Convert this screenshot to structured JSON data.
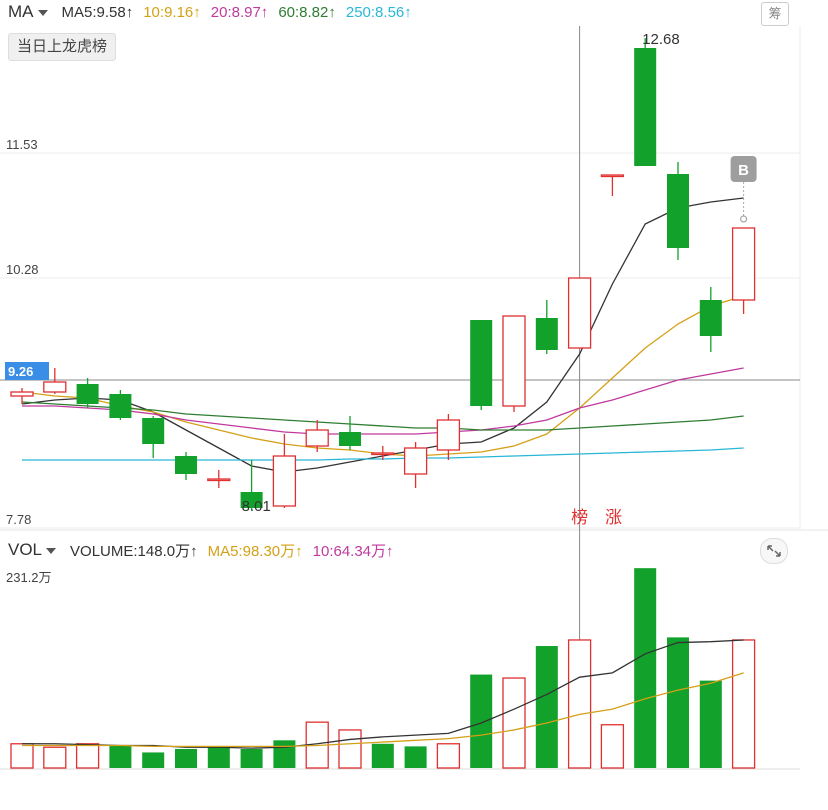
{
  "main_panel": {
    "indicator": "MA",
    "ma_values": [
      {
        "label": "MA5:9.58↑",
        "color": "#333333"
      },
      {
        "label": "10:9.16↑",
        "color": "#d4a017"
      },
      {
        "label": "20:8.97↑",
        "color": "#c0399f"
      },
      {
        "label": "60:8.82↑",
        "color": "#2e7d32"
      },
      {
        "label": "250:8.56↑",
        "color": "#29b6d8"
      }
    ],
    "button_label": "当日上龙虎榜",
    "right_badge": "筹"
  },
  "volume_panel": {
    "indicator": "VOL",
    "values": [
      {
        "label": "VOLUME:148.0万↑",
        "color": "#333333"
      },
      {
        "label": "MA5:98.30万↑",
        "color": "#d4a017"
      },
      {
        "label": "10:64.34万↑",
        "color": "#c0399f"
      }
    ]
  },
  "colors": {
    "up": "#e03030",
    "down": "#12a12a",
    "ma5": "#333333",
    "ma10": "#d4a017",
    "ma20": "#c0399f",
    "ma60": "#2e7d32",
    "ma250": "#29b6d8"
  },
  "chart_data": [
    {
      "type": "candlestick",
      "y_labels": [
        "11.53",
        "10.28",
        "7.78"
      ],
      "y_ticks": [
        11.53,
        10.28,
        7.78
      ],
      "ylim": [
        7.78,
        12.78
      ],
      "current_price_label": "9.26",
      "current_price": 9.26,
      "high_label": "12.68",
      "low_label": "8.01",
      "markers": [
        "B",
        "榜",
        "涨"
      ],
      "candles": [
        {
          "o": 9.1,
          "c": 9.14,
          "h": 9.18,
          "l": 9.02
        },
        {
          "o": 9.14,
          "c": 9.24,
          "h": 9.38,
          "l": 9.12
        },
        {
          "o": 9.22,
          "c": 9.02,
          "h": 9.28,
          "l": 8.98
        },
        {
          "o": 9.12,
          "c": 8.88,
          "h": 9.16,
          "l": 8.86
        },
        {
          "o": 8.88,
          "c": 8.62,
          "h": 8.9,
          "l": 8.48
        },
        {
          "o": 8.5,
          "c": 8.32,
          "h": 8.54,
          "l": 8.26
        },
        {
          "o": 8.27,
          "c": 8.27,
          "h": 8.36,
          "l": 8.18
        },
        {
          "o": 8.14,
          "c": 7.98,
          "h": 8.46,
          "l": 7.96
        },
        {
          "o": 8.0,
          "c": 8.5,
          "h": 8.72,
          "l": 7.98
        },
        {
          "o": 8.6,
          "c": 8.76,
          "h": 8.86,
          "l": 8.54
        },
        {
          "o": 8.74,
          "c": 8.6,
          "h": 8.9,
          "l": 8.56
        },
        {
          "o": 8.53,
          "c": 8.53,
          "h": 8.6,
          "l": 8.46
        },
        {
          "o": 8.32,
          "c": 8.58,
          "h": 8.64,
          "l": 8.18
        },
        {
          "o": 8.56,
          "c": 8.86,
          "h": 8.92,
          "l": 8.46
        },
        {
          "o": 9.86,
          "c": 9.0,
          "h": 9.86,
          "l": 8.96
        },
        {
          "o": 9.0,
          "c": 9.9,
          "h": 9.9,
          "l": 8.94
        },
        {
          "o": 9.88,
          "c": 9.56,
          "h": 10.06,
          "l": 9.52
        },
        {
          "o": 9.58,
          "c": 10.28,
          "h": 10.28,
          "l": 9.58
        },
        {
          "o": 11.31,
          "c": 11.31,
          "h": 11.31,
          "l": 11.1
        },
        {
          "o": 12.58,
          "c": 11.4,
          "h": 12.68,
          "l": 11.4
        },
        {
          "o": 11.32,
          "c": 10.58,
          "h": 11.44,
          "l": 10.46
        },
        {
          "o": 10.06,
          "c": 9.7,
          "h": 10.19,
          "l": 9.54
        },
        {
          "o": 10.06,
          "c": 10.78,
          "h": 10.78,
          "l": 9.92
        }
      ],
      "series": [
        {
          "key": "ma5",
          "values": [
            9.02,
            9.06,
            9.08,
            9.06,
            8.94,
            8.76,
            8.58,
            8.4,
            8.34,
            8.38,
            8.44,
            8.5,
            8.56,
            8.62,
            8.64,
            8.78,
            9.04,
            9.52,
            10.22,
            10.82,
            10.98,
            11.04,
            11.08
          ]
        },
        {
          "key": "ma10",
          "values": [
            9.14,
            9.1,
            9.08,
            9.0,
            8.94,
            8.84,
            8.76,
            8.68,
            8.62,
            8.58,
            8.56,
            8.52,
            8.5,
            8.52,
            8.54,
            8.6,
            8.72,
            8.98,
            9.28,
            9.58,
            9.82,
            10.0,
            10.1
          ]
        },
        {
          "key": "ma20",
          "values": [
            9.0,
            9.0,
            8.98,
            8.96,
            8.92,
            8.86,
            8.82,
            8.78,
            8.74,
            8.72,
            8.72,
            8.72,
            8.72,
            8.74,
            8.76,
            8.8,
            8.86,
            8.98,
            9.06,
            9.16,
            9.26,
            9.32,
            9.38
          ]
        },
        {
          "key": "ma60",
          "values": [
            9.04,
            9.02,
            9.0,
            8.98,
            8.96,
            8.92,
            8.9,
            8.88,
            8.86,
            8.84,
            8.82,
            8.8,
            8.78,
            8.78,
            8.76,
            8.76,
            8.76,
            8.78,
            8.8,
            8.82,
            8.84,
            8.86,
            8.9
          ]
        },
        {
          "key": "ma250",
          "values": [
            8.46,
            8.46,
            8.46,
            8.46,
            8.46,
            8.46,
            8.46,
            8.46,
            8.46,
            8.46,
            8.47,
            8.47,
            8.48,
            8.48,
            8.49,
            8.5,
            8.51,
            8.52,
            8.53,
            8.54,
            8.55,
            8.56,
            8.58
          ]
        }
      ]
    },
    {
      "type": "bar",
      "ylabel_top": "231.2万",
      "ylim": [
        0,
        231.2
      ],
      "unit": "万",
      "volumes": [
        28,
        24,
        28,
        26,
        18,
        22,
        24,
        22,
        32,
        53,
        44,
        28,
        25,
        28,
        108,
        104,
        141,
        148,
        50,
        231,
        151,
        101,
        148
      ],
      "directions": [
        "up",
        "up",
        "up",
        "down",
        "down",
        "down",
        "down",
        "down",
        "down",
        "up",
        "up",
        "down",
        "down",
        "up",
        "down",
        "up",
        "down",
        "up",
        "up",
        "down",
        "down",
        "down",
        "up"
      ],
      "series": [
        {
          "key": "ma5",
          "values": [
            28,
            28,
            27,
            26,
            26,
            24,
            24,
            23,
            24,
            28,
            33,
            36,
            38,
            40,
            52,
            68,
            85,
            105,
            110,
            132,
            145,
            146,
            148
          ]
        },
        {
          "key": "ma10",
          "values": [
            26,
            26,
            26,
            26,
            25,
            25,
            25,
            25,
            25,
            26,
            28,
            30,
            32,
            34,
            38,
            44,
            52,
            62,
            68,
            80,
            90,
            98,
            110
          ]
        }
      ]
    }
  ]
}
